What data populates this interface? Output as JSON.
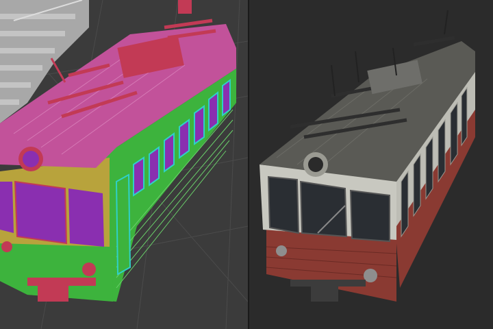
{
  "scene": {
    "left_view": {
      "mode": "id-map",
      "colors": {
        "background": "#3b3b3b",
        "grid": "#4a4a4a",
        "roof": "#c2529a",
        "roof_equipment": "#c23a55",
        "body_upper": "#b8a33c",
        "body_lower": "#3db33d",
        "windows": "#8a2fb0",
        "window_frames": "#2fd0c8",
        "stairs": "#b8b8b8"
      }
    },
    "right_view": {
      "mode": "textured",
      "colors": {
        "background": "#2b2b2b",
        "roof": "#5a5a55",
        "body_upper": "#c8c8c0",
        "body_lower": "#8a3a32",
        "windows": "#2a2e33",
        "metal": "#3c3c3c"
      }
    }
  }
}
